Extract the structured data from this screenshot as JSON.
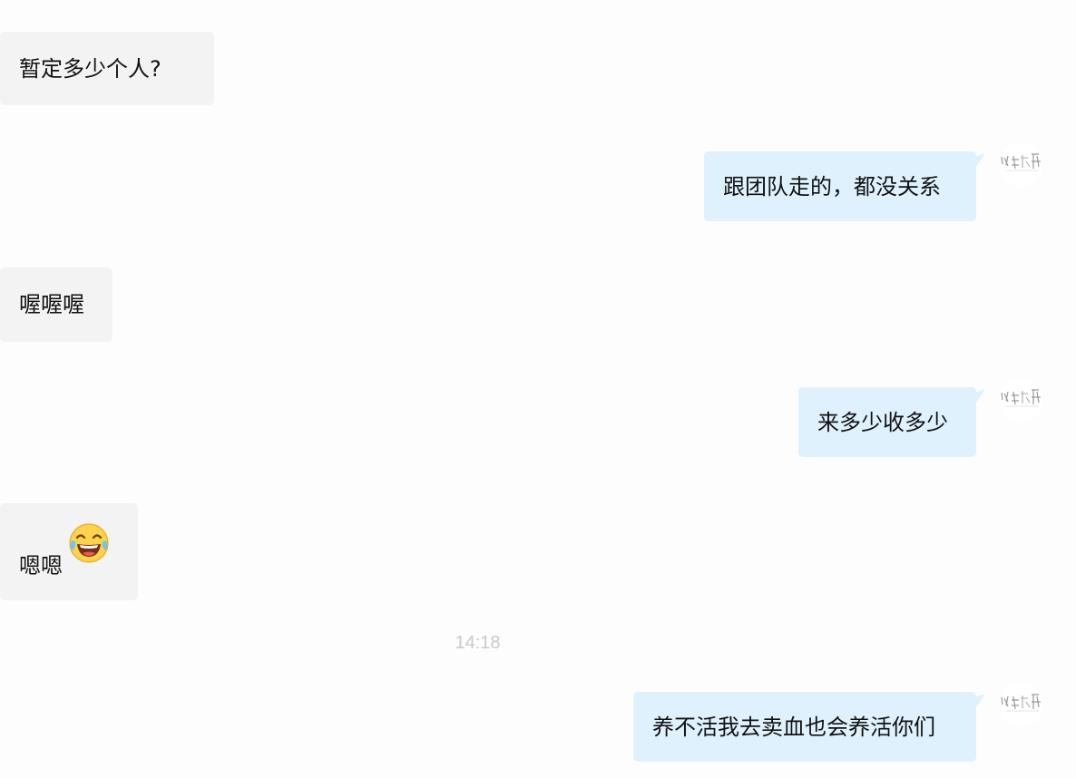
{
  "messages": [
    {
      "direction": "in",
      "text": "暂定多少个人?"
    },
    {
      "direction": "out",
      "text": "跟团队走的，都没关系"
    },
    {
      "direction": "in",
      "text": "喔喔喔"
    },
    {
      "direction": "out",
      "text": "来多少收多少"
    },
    {
      "direction": "in",
      "text": "嗯嗯",
      "emoji": "face-with-tears-of-joy-icon"
    },
    {
      "direction": "out",
      "text": "养不活我去卖血也会养活你们"
    }
  ],
  "timestamp": "14:18",
  "colors": {
    "incoming_bubble": "#f3f3f3",
    "outgoing_bubble": "#dff1fd",
    "timestamp": "#c9c9c9",
    "background": "#fdfdfd"
  }
}
